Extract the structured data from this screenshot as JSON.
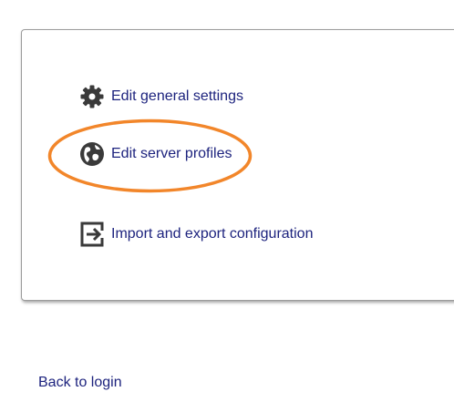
{
  "menu": {
    "items": [
      {
        "label": "Edit general settings",
        "icon": "gear-icon"
      },
      {
        "label": "Edit server profiles",
        "icon": "globe-icon"
      },
      {
        "label": "Import and export configuration",
        "icon": "import-export-icon"
      }
    ]
  },
  "footer": {
    "back_label": "Back to login"
  },
  "colors": {
    "link": "#1d237e",
    "icon": "#3a3a3a",
    "highlight": "#f2862a",
    "panel_border": "#9b9b9b"
  }
}
